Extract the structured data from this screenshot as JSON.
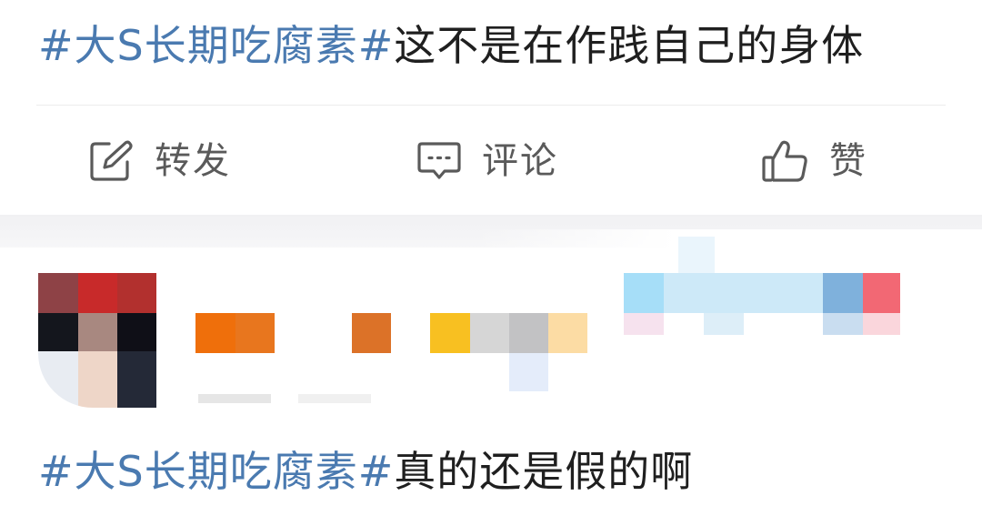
{
  "post1": {
    "hashtag": "#大S长期吃腐素#",
    "body": "这不是在作践自己的身体"
  },
  "actions": {
    "repost": {
      "label": "转发",
      "icon": "edit-square-icon"
    },
    "comment": {
      "label": "评论",
      "icon": "comment-bubble-icon"
    },
    "like": {
      "label": "赞",
      "icon": "thumbs-up-icon"
    }
  },
  "post2": {
    "hashtag": "#大S长期吃腐素#",
    "body": "真的还是假的啊"
  },
  "colors": {
    "hashtag": "#4a7ab0",
    "text": "#1f1f1f",
    "action": "#5a5a5a",
    "divider": "#ececec"
  }
}
